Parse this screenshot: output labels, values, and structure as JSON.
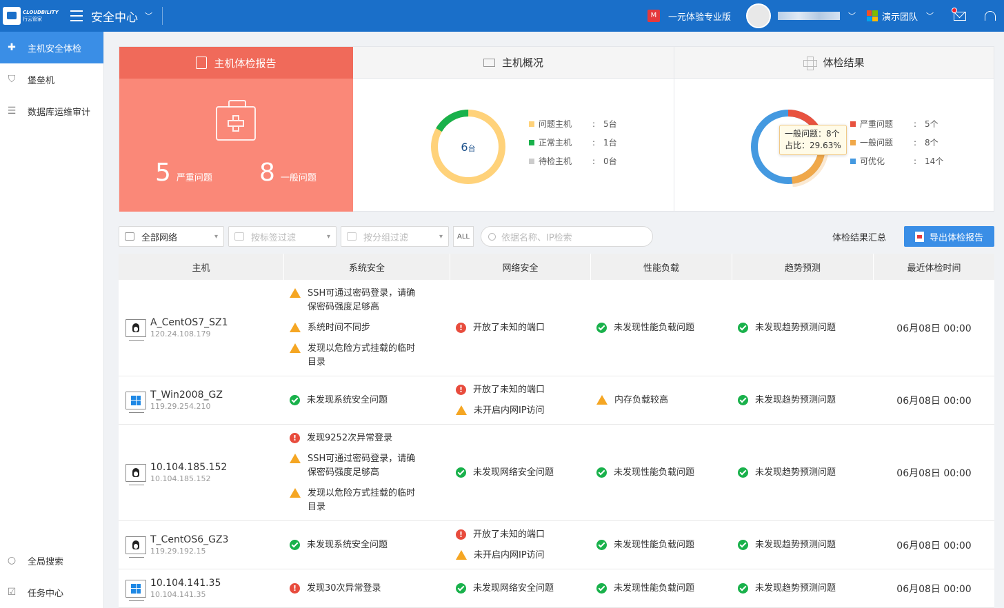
{
  "header": {
    "logo_line1": "CLOUDBILITY",
    "logo_line2": "行云管家",
    "title": "安全中心",
    "trial_label": "一元体验专业版",
    "team_label": "演示团队"
  },
  "sidebar": {
    "items": [
      {
        "label": "主机安全体检",
        "icon": "medical-plus-icon",
        "active": true
      },
      {
        "label": "堡垒机",
        "icon": "shield-icon"
      },
      {
        "label": "数据库运维审计",
        "icon": "database-icon"
      }
    ],
    "bottom_items": [
      {
        "label": "全局搜索",
        "icon": "search-icon"
      },
      {
        "label": "任务中心",
        "icon": "task-icon"
      }
    ]
  },
  "report_panel": {
    "title": "主机体检报告",
    "serious_count": "5",
    "serious_label": "严重问题",
    "general_count": "8",
    "general_label": "一般问题"
  },
  "overview_panel": {
    "title": "主机概况",
    "center_num": "6",
    "center_unit": "台",
    "legend": [
      {
        "name": "问题主机",
        "value": "5台",
        "color": "#ffd27a"
      },
      {
        "name": "正常主机",
        "value": "1台",
        "color": "#19b14b"
      },
      {
        "name": "待检主机",
        "value": "0台",
        "color": "#cccccc"
      }
    ]
  },
  "result_panel": {
    "title": "体检结果",
    "legend": [
      {
        "name": "严重问题",
        "value": "5个",
        "color": "#e8523f"
      },
      {
        "name": "一般问题",
        "value": "8个",
        "color": "#f0a84a"
      },
      {
        "name": "可优化",
        "value": "14个",
        "color": "#4499e0"
      }
    ],
    "tooltip_line1": "一般问题：8个",
    "tooltip_line2": "占比：29.63%"
  },
  "filters": {
    "network": "全部网络",
    "tag_placeholder": "按标签过滤",
    "group_placeholder": "按分组过滤",
    "all_label": "ALL",
    "search_placeholder": "依据名称、IP检索",
    "summary_link": "体检结果汇总",
    "export_label": "导出体检报告"
  },
  "table": {
    "columns": [
      "主机",
      "系统安全",
      "网络安全",
      "性能负载",
      "趋势预测",
      "最近体检时间"
    ],
    "rows": [
      {
        "os": "linux",
        "name": "A_CentOS7_SZ1",
        "ip": "120.24.108.179",
        "system": [
          {
            "type": "warn",
            "text": "SSH可通过密码登录，请确保密码强度足够高"
          },
          {
            "type": "warn",
            "text": "系统时间不同步"
          },
          {
            "type": "warn",
            "text": "发现以危险方式挂载的临时目录"
          }
        ],
        "network": [
          {
            "type": "err",
            "text": "开放了未知的端口"
          }
        ],
        "perf": [
          {
            "type": "ok",
            "text": "未发现性能负载问题"
          }
        ],
        "trend": [
          {
            "type": "ok",
            "text": "未发现趋势预测问题"
          }
        ],
        "time": "06月08日 00:00"
      },
      {
        "os": "windows",
        "name": "T_Win2008_GZ",
        "ip": "119.29.254.210",
        "system": [
          {
            "type": "ok",
            "text": "未发现系统安全问题"
          }
        ],
        "network": [
          {
            "type": "err",
            "text": "开放了未知的端口"
          },
          {
            "type": "warn",
            "text": "未开启内网IP访问"
          }
        ],
        "perf": [
          {
            "type": "warn",
            "text": "内存负载较高"
          }
        ],
        "trend": [
          {
            "type": "ok",
            "text": "未发现趋势预测问题"
          }
        ],
        "time": "06月08日 00:00"
      },
      {
        "os": "linux",
        "name": "10.104.185.152",
        "ip": "10.104.185.152",
        "system": [
          {
            "type": "err",
            "text": "发现9252次异常登录"
          },
          {
            "type": "warn",
            "text": "SSH可通过密码登录，请确保密码强度足够高"
          },
          {
            "type": "warn",
            "text": "发现以危险方式挂载的临时目录"
          }
        ],
        "network": [
          {
            "type": "ok",
            "text": "未发现网络安全问题"
          }
        ],
        "perf": [
          {
            "type": "ok",
            "text": "未发现性能负载问题"
          }
        ],
        "trend": [
          {
            "type": "ok",
            "text": "未发现趋势预测问题"
          }
        ],
        "time": "06月08日 00:00"
      },
      {
        "os": "linux",
        "name": "T_CentOS6_GZ3",
        "ip": "119.29.192.15",
        "system": [
          {
            "type": "ok",
            "text": "未发现系统安全问题"
          }
        ],
        "network": [
          {
            "type": "err",
            "text": "开放了未知的端口"
          },
          {
            "type": "warn",
            "text": "未开启内网IP访问"
          }
        ],
        "perf": [
          {
            "type": "ok",
            "text": "未发现性能负载问题"
          }
        ],
        "trend": [
          {
            "type": "ok",
            "text": "未发现趋势预测问题"
          }
        ],
        "time": "06月08日 00:00"
      },
      {
        "os": "windows",
        "name": "10.104.141.35",
        "ip": "10.104.141.35",
        "system": [
          {
            "type": "err",
            "text": "发现30次异常登录"
          }
        ],
        "network": [
          {
            "type": "ok",
            "text": "未发现网络安全问题"
          }
        ],
        "perf": [
          {
            "type": "ok",
            "text": "未发现性能负载问题"
          }
        ],
        "trend": [
          {
            "type": "ok",
            "text": "未发现趋势预测问题"
          }
        ],
        "time": "06月08日 00:00"
      }
    ]
  }
}
